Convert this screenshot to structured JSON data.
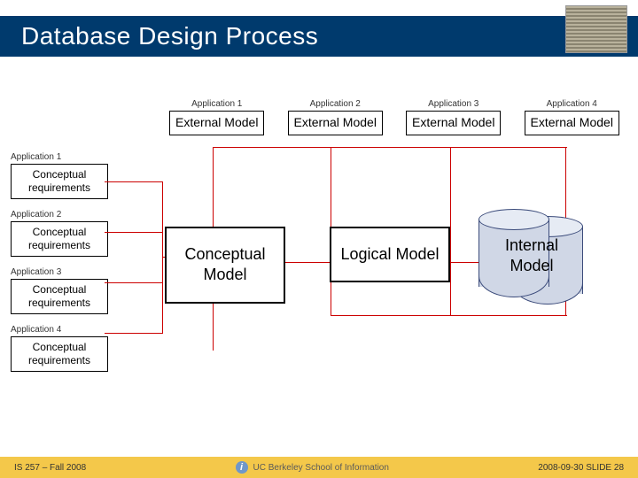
{
  "title": "Database Design Process",
  "external_models": [
    {
      "app": "Application 1",
      "label": "External Model"
    },
    {
      "app": "Application 2",
      "label": "External Model"
    },
    {
      "app": "Application 3",
      "label": "External Model"
    },
    {
      "app": "Application 4",
      "label": "External Model"
    }
  ],
  "requirements": [
    {
      "app": "Application 1",
      "label": "Conceptual requirements"
    },
    {
      "app": "Application 2",
      "label": "Conceptual requirements"
    },
    {
      "app": "Application 3",
      "label": "Conceptual requirements"
    },
    {
      "app": "Application 4",
      "label": "Conceptual requirements"
    }
  ],
  "models": {
    "conceptual": "Conceptual Model",
    "logical": "Logical Model",
    "internal": "Internal Model"
  },
  "footer": {
    "left": "IS 257 – Fall 2008",
    "mid": "UC Berkeley School of Information",
    "right": "2008-09-30  SLIDE 28"
  },
  "chart_data": {
    "type": "diagram",
    "title": "Database Design Process",
    "nodes": [
      {
        "id": "req1",
        "label": "Conceptual requirements",
        "group": "Application 1"
      },
      {
        "id": "req2",
        "label": "Conceptual requirements",
        "group": "Application 2"
      },
      {
        "id": "req3",
        "label": "Conceptual requirements",
        "group": "Application 3"
      },
      {
        "id": "req4",
        "label": "Conceptual requirements",
        "group": "Application 4"
      },
      {
        "id": "cm",
        "label": "Conceptual Model"
      },
      {
        "id": "lm",
        "label": "Logical Model"
      },
      {
        "id": "im",
        "label": "Internal Model",
        "shape": "cylinder"
      },
      {
        "id": "ext1",
        "label": "External Model",
        "group": "Application 1"
      },
      {
        "id": "ext2",
        "label": "External Model",
        "group": "Application 2"
      },
      {
        "id": "ext3",
        "label": "External Model",
        "group": "Application 3"
      },
      {
        "id": "ext4",
        "label": "External Model",
        "group": "Application 4"
      }
    ],
    "edges": [
      {
        "from": "req1",
        "to": "cm"
      },
      {
        "from": "req2",
        "to": "cm"
      },
      {
        "from": "req3",
        "to": "cm"
      },
      {
        "from": "req4",
        "to": "cm"
      },
      {
        "from": "cm",
        "to": "lm"
      },
      {
        "from": "lm",
        "to": "im"
      },
      {
        "from": "cm",
        "to": "ext1"
      },
      {
        "from": "lm",
        "to": "ext2"
      },
      {
        "from": "lm",
        "to": "ext3"
      },
      {
        "from": "im",
        "to": "ext4"
      }
    ]
  }
}
